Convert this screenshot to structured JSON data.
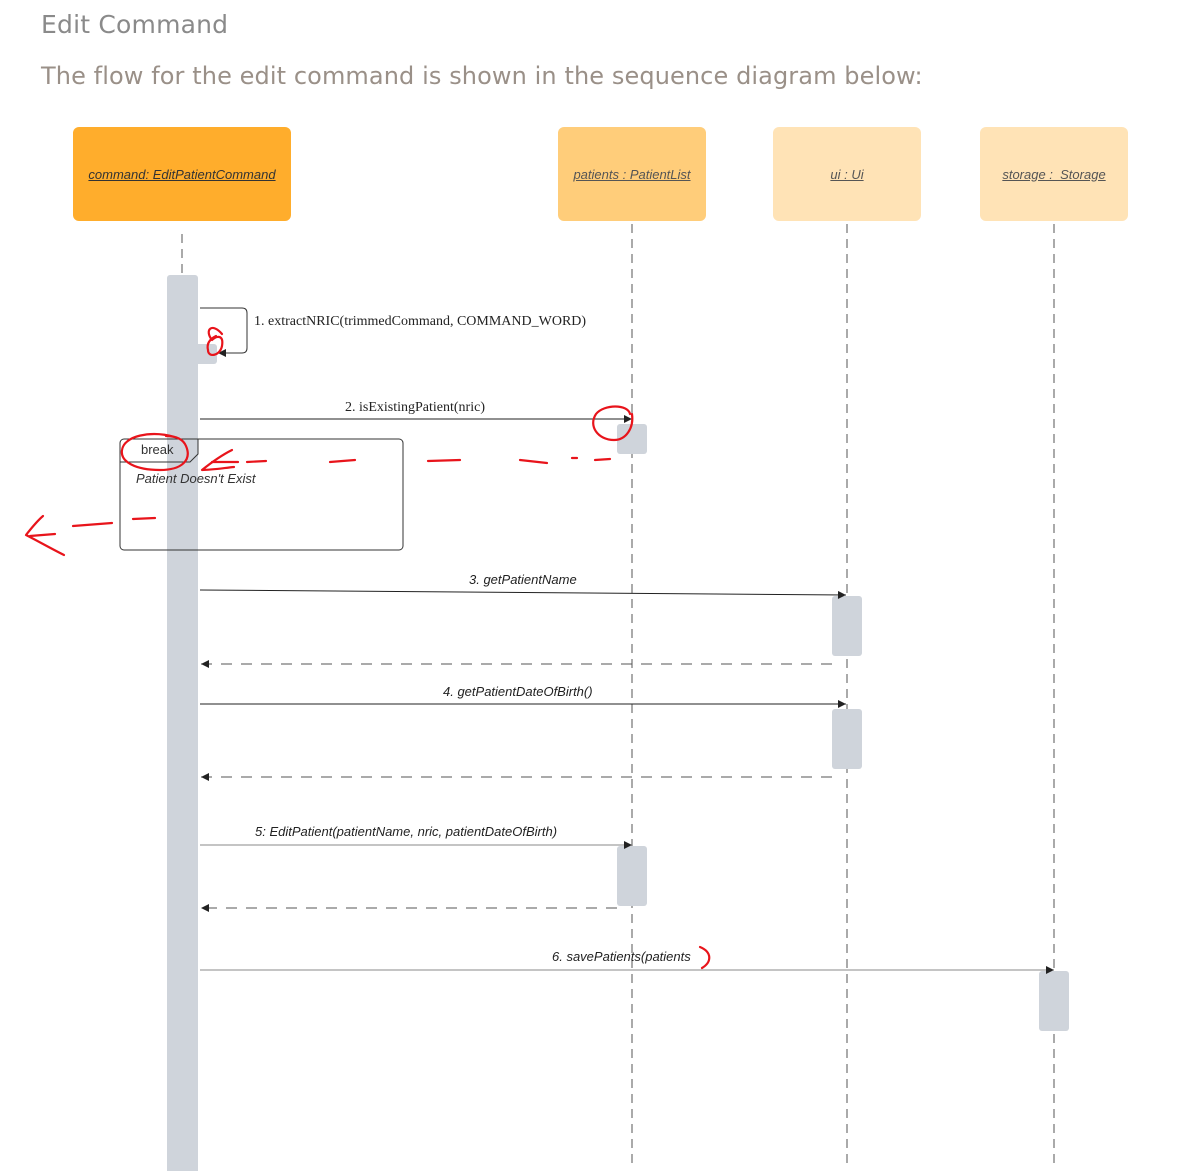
{
  "page": {
    "title": "Edit Command",
    "subtitle": "The flow for the edit command is shown in the sequence diagram below:"
  },
  "participants": {
    "command": "command: EditPatientCommand",
    "patients": "patients : PatientList",
    "ui": "ui : Ui",
    "storage": "storage :  Storage"
  },
  "messages": {
    "m1": "1. extractNRIC(trimmedCommand, COMMAND_WORD)",
    "m2": "2. isExistingPatient(nric)",
    "m3": "3. getPatientName",
    "m4": "4. getPatientDateOfBirth()",
    "m5": "5: EditPatient(patientName, nric, patientDateOfBirth)",
    "m6": "6. savePatients(patients"
  },
  "fragment": {
    "label": "break",
    "condition": "Patient Doesn't Exist"
  },
  "colors": {
    "command": "#ffad2c",
    "patients": "#ffcd7a",
    "ui": "#ffe3b6",
    "storage": "#ffe3b6",
    "activation": "#cfd4db",
    "annotation": "#e8141b"
  }
}
